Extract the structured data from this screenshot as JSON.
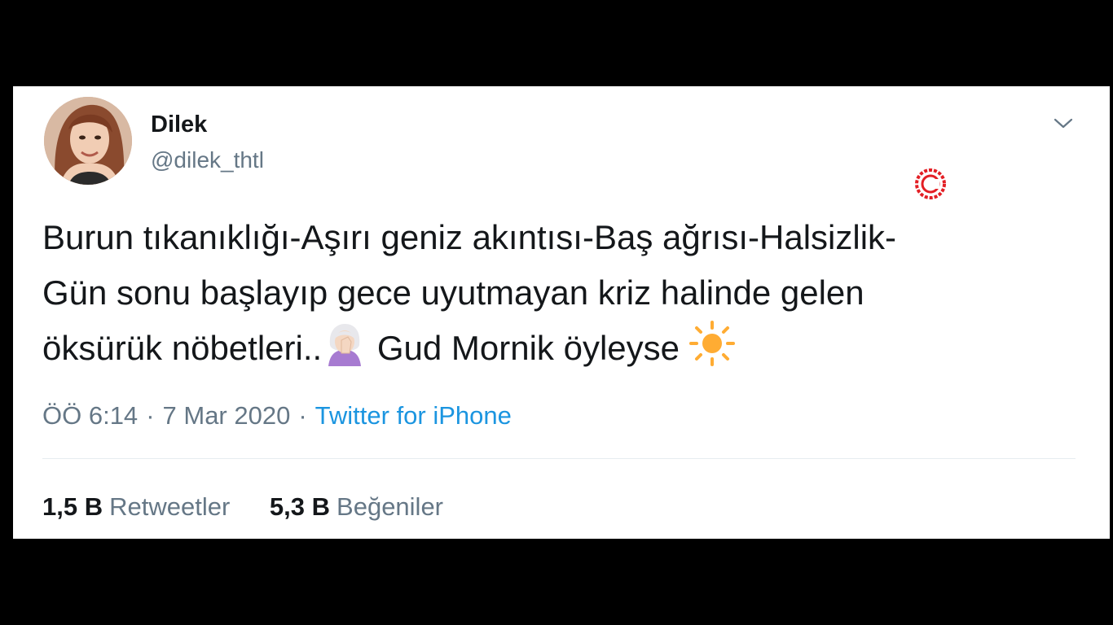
{
  "tweet": {
    "author": {
      "display_name": "Dilek",
      "handle": "@dilek_thtl"
    },
    "text_lines": [
      "Burun tıkanıklığı-Aşırı geniz akıntısı-Baş ağrısı-Halsizlik-",
      "Gün sonu başlayıp gece uyutmayan kriz halinde gelen",
      "öksürük nöbetleri.."
    ],
    "text_tail": "Gud Mornik öyleyse",
    "emojis": [
      "facepalm-woman-icon",
      "sun-icon"
    ],
    "timestamp": "ÖÖ 6:14",
    "date": "7 Mar 2020",
    "separator": "·",
    "source": "Twitter for iPhone",
    "stats": {
      "retweets_count": "1,5 B",
      "retweets_label": "Retweetler",
      "likes_count": "5,3 B",
      "likes_label": "Beğeniler"
    }
  },
  "colors": {
    "text": "#14171a",
    "secondary": "#657786",
    "link": "#1b95e0",
    "divider": "#e6ecf0",
    "watermark": "#e31e24"
  }
}
